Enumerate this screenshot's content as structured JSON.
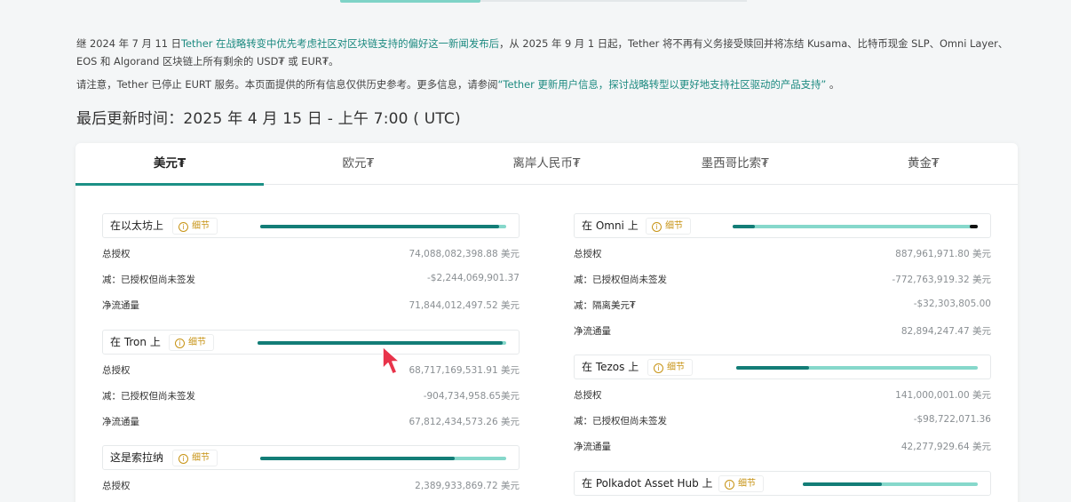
{
  "notice": {
    "line1_prefix": "继 2024 年 7 月 11 日",
    "line1_link": "Tether 在战略转变中优先考虑社区对区块链支持的偏好这一新闻发布后",
    "line1_rest": "，从 2025 年 9 月 1 日起，Tether 将不再有义务接受赎回并将冻结 Kusama、比特币现金 SLP、Omni Layer、EOS 和 Algorand 区块链上所有剩余的 USD₮ 或 EUR₮。",
    "line2_prefix": "请注意，Tether 已停止 EURT 服务。本页面提供的所有信息仅供历史参考。更多信息，请参阅",
    "line2_link": "“Tether 更新用户信息，探讨战略转型以更好地支持社区驱动的产品支持”",
    "line2_suffix": " 。"
  },
  "updated": "最后更新时间：2025 年 4 月 15 日 - 上午 7:00 ( UTC)",
  "tabs": [
    "美元₮",
    "欧元₮",
    "离岸人民币₮",
    "墨西哥比索₮",
    "黄金₮"
  ],
  "detail_label": "细节",
  "left": [
    {
      "name": "在以太坊上",
      "bar_fraction": 0.97,
      "rows": [
        {
          "label": "总授权",
          "value": "74,088,082,398.88 美元"
        },
        {
          "label": "减：已授权但尚未签发",
          "value": "-$2,244,069,901.37"
        },
        {
          "label": "净流通量",
          "value": "71,844,012,497.52 美元"
        }
      ]
    },
    {
      "name": "在 Tron 上",
      "bar_fraction": 0.985,
      "rows": [
        {
          "label": "总授权",
          "value": "68,717,169,531.91 美元"
        },
        {
          "label": "减：已授权但尚未签发",
          "value": "-904,734,958.65美元"
        },
        {
          "label": "净流通量",
          "value": "67,812,434,573.26 美元"
        }
      ]
    },
    {
      "name": "这是索拉纳",
      "bar_fraction": 0.79,
      "rows": [
        {
          "label": "总授权",
          "value": "2,389,933,869.72 美元"
        }
      ]
    }
  ],
  "right": [
    {
      "name": "在 Omni 上",
      "bar_fraction": 0.09,
      "rows": [
        {
          "label": "总授权",
          "value": "887,961,971.80 美元"
        },
        {
          "label": "减：已授权但尚未签发",
          "value": "-772,763,919.32 美元"
        },
        {
          "label": "减：隔离美元₮",
          "value": "-$32,303,805.00"
        },
        {
          "label": "净流通量",
          "value": "82,894,247.47 美元"
        }
      ]
    },
    {
      "name": "在 Tezos 上",
      "bar_fraction": 0.3,
      "rows": [
        {
          "label": "总授权",
          "value": "141,000,001.00 美元"
        },
        {
          "label": "减：已授权但尚未签发",
          "value": "-$98,722,071.36"
        },
        {
          "label": "净流通量",
          "value": "42,277,929.64 美元"
        }
      ]
    },
    {
      "name": "在 Polkadot Asset Hub 上",
      "bar_fraction": 0.45,
      "rows": []
    }
  ],
  "colors": {
    "accent": "#1c9086",
    "bar_fill": "#137d77",
    "bar_track": "#86d8cb",
    "detail": "#c79314"
  }
}
